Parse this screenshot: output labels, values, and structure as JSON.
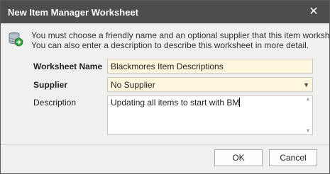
{
  "window": {
    "title": "New Item Manager Worksheet",
    "close_glyph": "✕"
  },
  "info": {
    "icon": "database-arrow-icon",
    "line1": "You must choose a friendly name and an optional supplier that this item worksheet uses",
    "line2": "You can also enter a description to describe this worksheet in more detail."
  },
  "form": {
    "worksheet_name_label": "Worksheet Name",
    "worksheet_name_value": "Blackmores Item Descriptions",
    "supplier_label": "Supplier",
    "supplier_value": "No Supplier",
    "description_label": "Description",
    "description_value": "Updating all items to start with BM"
  },
  "buttons": {
    "ok": "OK",
    "cancel": "Cancel"
  },
  "colors": {
    "titlebar": "#4d4d4d",
    "field_bg": "#fff7dd",
    "dialog_bg": "#f0f0f0"
  }
}
